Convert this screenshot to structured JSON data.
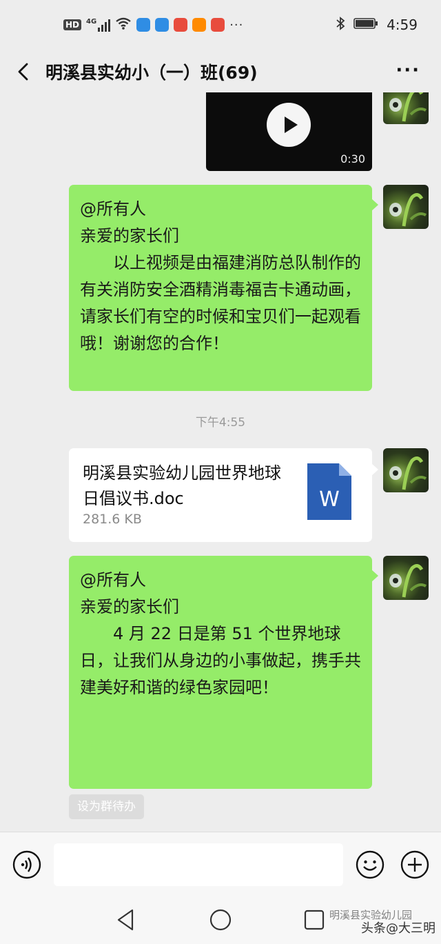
{
  "status_bar": {
    "network_label": "HD",
    "signal_label": "4G",
    "time": "4:59",
    "more": "···",
    "app_icon_colors": [
      "#2f8de4",
      "#2f8de4",
      "#e84c3d",
      "#ff8a00",
      "#e84c3d"
    ]
  },
  "header": {
    "title": "明溪县实幼小（一）班(69)",
    "more_label": "···"
  },
  "messages": {
    "video": {
      "duration": "0:30"
    },
    "notice1": {
      "mention": "@所有人",
      "greeting": "亲爱的家长们",
      "body": "以上视频是由福建消防总队制作的有关消防安全酒精消毒福吉卡通动画，请家长们有空的时候和宝贝们一起观看哦！谢谢您的合作！"
    },
    "timestamp": "下午4:55",
    "file": {
      "name": "明溪县实验幼儿园世界地球日倡议书.doc",
      "size": "281.6 KB",
      "icon_letter": "W",
      "icon_color": "#2b5fb4"
    },
    "notice2": {
      "mention": "@所有人",
      "greeting": "亲爱的家长们",
      "body": "4 月 22 日是第 51 个世界地球日，让我们从身边的小事做起，携手共建美好和谐的绿色家园吧！"
    },
    "todo_label": "设为群待办"
  },
  "input_bar": {
    "placeholder": ""
  },
  "watermark": {
    "line1": "明溪县实验幼儿园",
    "line2": "头条@大三明"
  },
  "colors": {
    "bubble_green": "#95ec69",
    "background": "#ededed"
  }
}
